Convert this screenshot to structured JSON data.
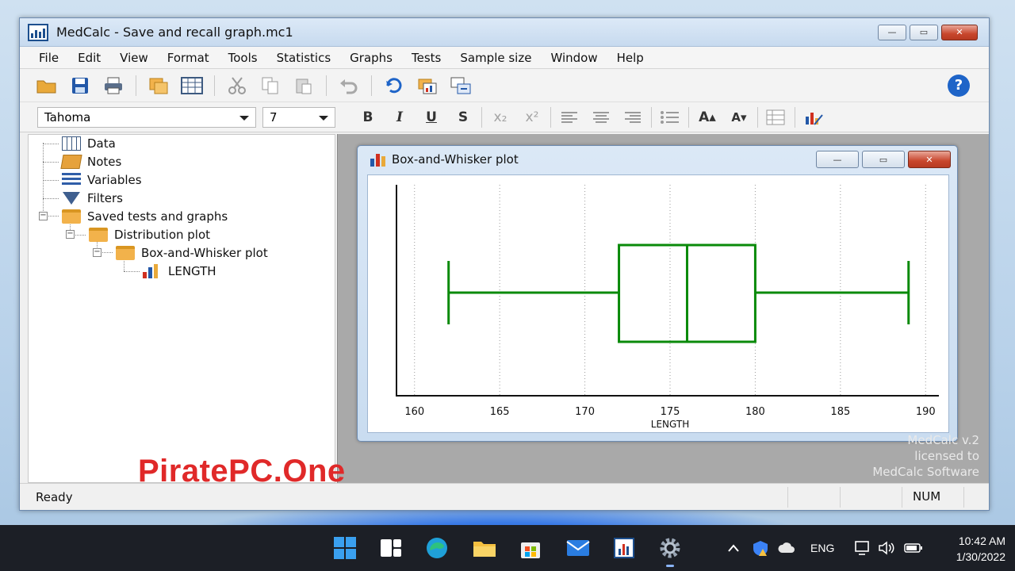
{
  "window": {
    "title": "MedCalc - Save and recall graph.mc1",
    "minimize": "—",
    "maximize": "▭",
    "close": "✕"
  },
  "menu": [
    "File",
    "Edit",
    "View",
    "Format",
    "Tools",
    "Statistics",
    "Graphs",
    "Tests",
    "Sample size",
    "Window",
    "Help"
  ],
  "format_toolbar": {
    "font": "Tahoma",
    "size": "7",
    "bold": "B",
    "italic": "I",
    "underline": "U",
    "strike": "S",
    "subscript": "x₂",
    "superscript": "x²",
    "grow": "A▴",
    "shrink": "A▾"
  },
  "tree": {
    "data": "Data",
    "notes": "Notes",
    "variables": "Variables",
    "filters": "Filters",
    "saved": "Saved tests and graphs",
    "distribution": "Distribution plot",
    "boxwhisker": "Box-and-Whisker plot",
    "length": "LENGTH"
  },
  "child_window": {
    "title": "Box-and-Whisker plot"
  },
  "chart_data": {
    "type": "box",
    "orientation": "horizontal",
    "xlabel": "LENGTH",
    "xlim": [
      159.5,
      190.5
    ],
    "ticks": [
      160,
      165,
      170,
      175,
      180,
      185,
      190
    ],
    "tick_labels": [
      "160",
      "165",
      "170",
      "175",
      "180",
      "185",
      "190"
    ],
    "grid": "vertical dotted",
    "box": {
      "whisker_low": 162,
      "q1": 172,
      "median": 176,
      "q3": 180,
      "whisker_high": 189
    },
    "color": "#0a8a0a"
  },
  "watermark": {
    "line1": "MedCalc v.2",
    "line2": "licensed to",
    "line3": "MedCalc Software"
  },
  "status": {
    "text": "Ready",
    "num": "NUM"
  },
  "brand": "PiratePC.One",
  "taskbar": {
    "lang": "ENG",
    "time": "10:42 AM",
    "date": "1/30/2022"
  }
}
